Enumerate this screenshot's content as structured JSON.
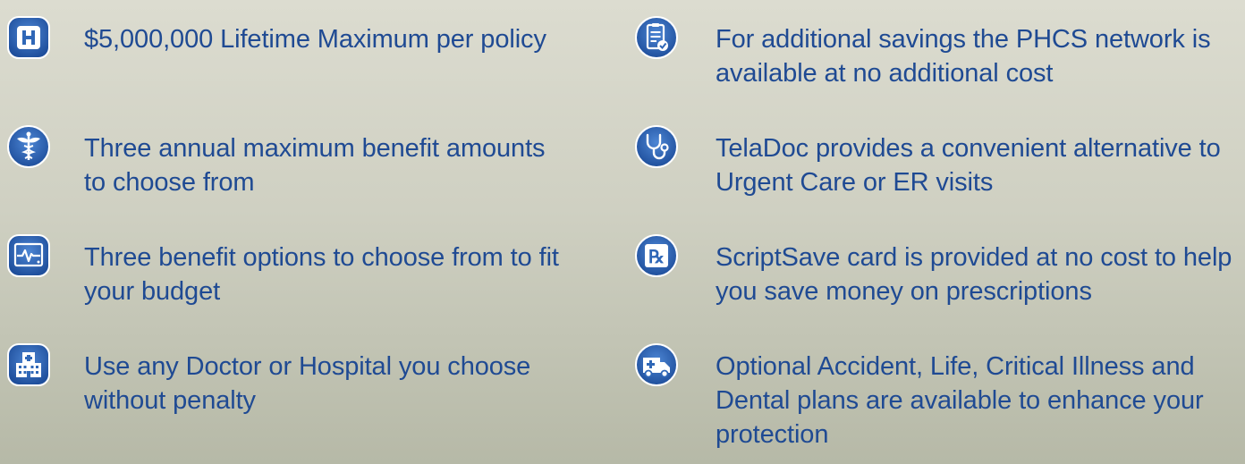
{
  "colors": {
    "text": "#1f4a93",
    "icon_fill": "#2f67b7",
    "icon_ring": "#ffffff",
    "background_top": "#dcdcd0",
    "background_bottom": "#b6b9a7"
  },
  "left_features": [
    {
      "text": "$5,000,000 Lifetime Maximum per policy",
      "icon": "hospital-h-icon"
    },
    {
      "text": "Three annual maximum benefit amounts  to choose from",
      "icon": "caduceus-icon"
    },
    {
      "text": "Three benefit options to choose from to fit your budget",
      "icon": "heart-monitor-icon"
    },
    {
      "text": "Use any Doctor or Hospital you choose without penalty",
      "icon": "hospital-building-icon"
    }
  ],
  "right_features": [
    {
      "text": "For additional savings the PHCS network is available at no additional cost",
      "icon": "clipboard-check-icon"
    },
    {
      "text": "TelaDoc provides a convenient alternative to Urgent Care or ER visits",
      "icon": "stethoscope-icon"
    },
    {
      "text": "ScriptSave card is provided at no cost to help you save money on prescriptions",
      "icon": "prescription-rx-icon"
    },
    {
      "text": "Optional Accident, Life, Critical Illness and Dental plans are available to enhance your protection",
      "icon": "ambulance-icon"
    }
  ]
}
